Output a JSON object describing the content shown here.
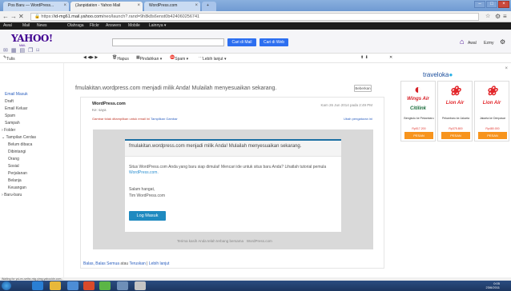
{
  "browser": {
    "tabs": [
      {
        "label": "Pos Baru — WordPress..."
      },
      {
        "label": "(Janpidation - Yahoo Mail"
      },
      {
        "label": "WordPress.com"
      }
    ],
    "url_prefix": "https://",
    "url_host": "id-mg61.mail.yahoo.com",
    "url_rest": "/neo/launch?.rand=9h8k8s6enst0b424060256741",
    "new_tab": "+"
  },
  "yahoo_nav": {
    "items": [
      "Awal",
      "Mail",
      "News",
      "Olahraga",
      "Flickr",
      "Answers",
      "Mobile",
      "Lainnya ▾"
    ]
  },
  "header": {
    "logo": "YAHOO!",
    "logo_sub": "MAIL",
    "search_mail": "Cari di Mail",
    "search_web": "Cari di Web",
    "home": "Awal",
    "user": "Ezmy"
  },
  "toolbar": {
    "compose": "Tulis",
    "hapus": "Hapus",
    "pindahkan": "Pindahkan ▾",
    "spam": "Spam ▾",
    "lebih": "Lebih lanjut ▾"
  },
  "sidebar": {
    "items": [
      "Email Masuk",
      "Draft",
      "Email Keluar",
      "Spam",
      "Sampah",
      "Folder",
      "Tampilan Cerdas",
      "Belum dibaca",
      "Dibintangi",
      "Orang",
      "Sosial",
      "Perjalanan",
      "Belanja",
      "Keuangan",
      "Baru-baru"
    ],
    "footer": "Waiting for yui-ex-sethx-mig.yimg.yahooidn.com..."
  },
  "mail": {
    "subject": "fmulakitan.wordpress.com menjadi milik Anda! Mulailah menyesuaikan sekarang.",
    "subject_button": "Beberkan",
    "sender": "WordPress.com",
    "to": "Ke: saya",
    "date": "Kam 26 Jun 2014 pada 2:49 PM",
    "warning": "Gambar tidak ditampilkan untuk email ini",
    "warning_link": "Tampilkan Gambar",
    "warning_right": "Ubah pengaturan ini",
    "card_head": "fmulakitan.wordpress.com menjadi milik Anda! Mulailah menyesuaikan sekarang.",
    "card_para1": "Situs WordPress.com Anda yang baru siap dimulai! Mencari ide untuk situs baru Anda? Lihatlah tutorial pemula",
    "card_link": "WordPress.com.",
    "card_greeting": "Salam hangat,",
    "card_sign": "Tim WordPress.com",
    "login": "Log Masuk",
    "footer_thanks": "Terima kasih Anda telah terbang bersama",
    "footer_brand": "WordPress.com",
    "reply": "Balas, Balas Semua",
    "reply_or": "atau",
    "forward": "Teruskan",
    "more": "Lebih lanjut"
  },
  "ad": {
    "brand": "traveloka",
    "close": "×",
    "panels": [
      {
        "logo": "Wings Air",
        "label": "Bengkulu ke Pekanbaru",
        "price": "Rp517.200",
        "cta": "PESAN"
      },
      {
        "logo": "Lion Air",
        "label": "Pekanbaru ke Jakarta",
        "price": "Rp375.800",
        "cta": "PESAN"
      },
      {
        "logo": "Lion Air",
        "label": "Jakarta ke Denpasar",
        "price": "Rp480.000",
        "cta": "PESAN"
      }
    ],
    "citilink": "Citilink"
  },
  "status_bar": {
    "text": "Waiting for yui-ex-sethx-mig.yimg.yahooidn.com..."
  },
  "taskbar": {
    "time": "0:05",
    "date": "23/6/2011"
  }
}
